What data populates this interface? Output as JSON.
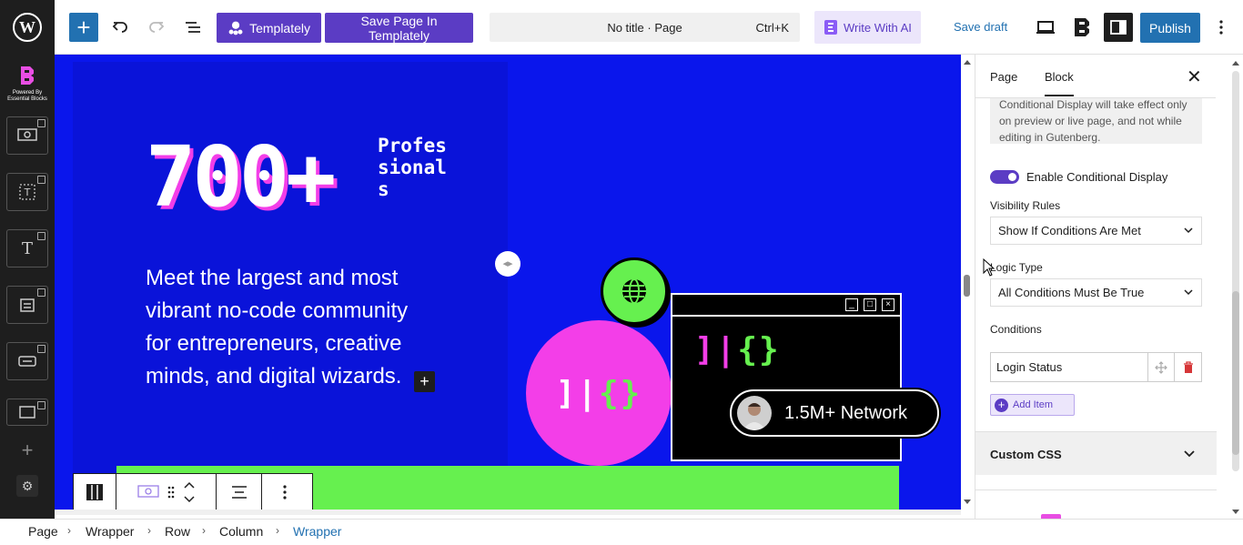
{
  "toolbar": {
    "templately_label": "Templately",
    "save_templately_label": "Save Page In Templately",
    "command_title": "No title · Page",
    "command_shortcut": "Ctrl+K",
    "write_ai_label": "Write With AI",
    "save_draft_label": "Save draft",
    "publish_label": "Publish"
  },
  "leftbar": {
    "logo_text": "Powered By Essential Blocks"
  },
  "canvas": {
    "big_number": "700+",
    "big_number_label": "Professionals",
    "description": "Meet the largest and most vibrant no-code community for entrepreneurs, creative minds, and digital wizards.",
    "code_glyph_white": "]|",
    "code_glyph_green": "{}",
    "network_label": "1.5M+ Network",
    "colors": {
      "background": "#0a16ec",
      "pink": "#f33ee8",
      "green": "#66f04f"
    }
  },
  "inspector": {
    "tab_page": "Page",
    "tab_block": "Block",
    "notice_text": "Conditional Display will take effect only on preview or live page, and not while editing in Gutenberg.",
    "toggle_label": "Enable Conditional Display",
    "visibility_label": "Visibility Rules",
    "visibility_value": "Show If Conditions Are Met",
    "logic_label": "Logic Type",
    "logic_value": "All Conditions Must Be True",
    "conditions_label": "Conditions",
    "condition_value": "Login Status",
    "add_item_label": "Add Item",
    "custom_css_label": "Custom CSS",
    "accent": "#5b3cc4"
  },
  "breadcrumb": [
    "Page",
    "Wrapper",
    "Row",
    "Column",
    "Wrapper"
  ]
}
